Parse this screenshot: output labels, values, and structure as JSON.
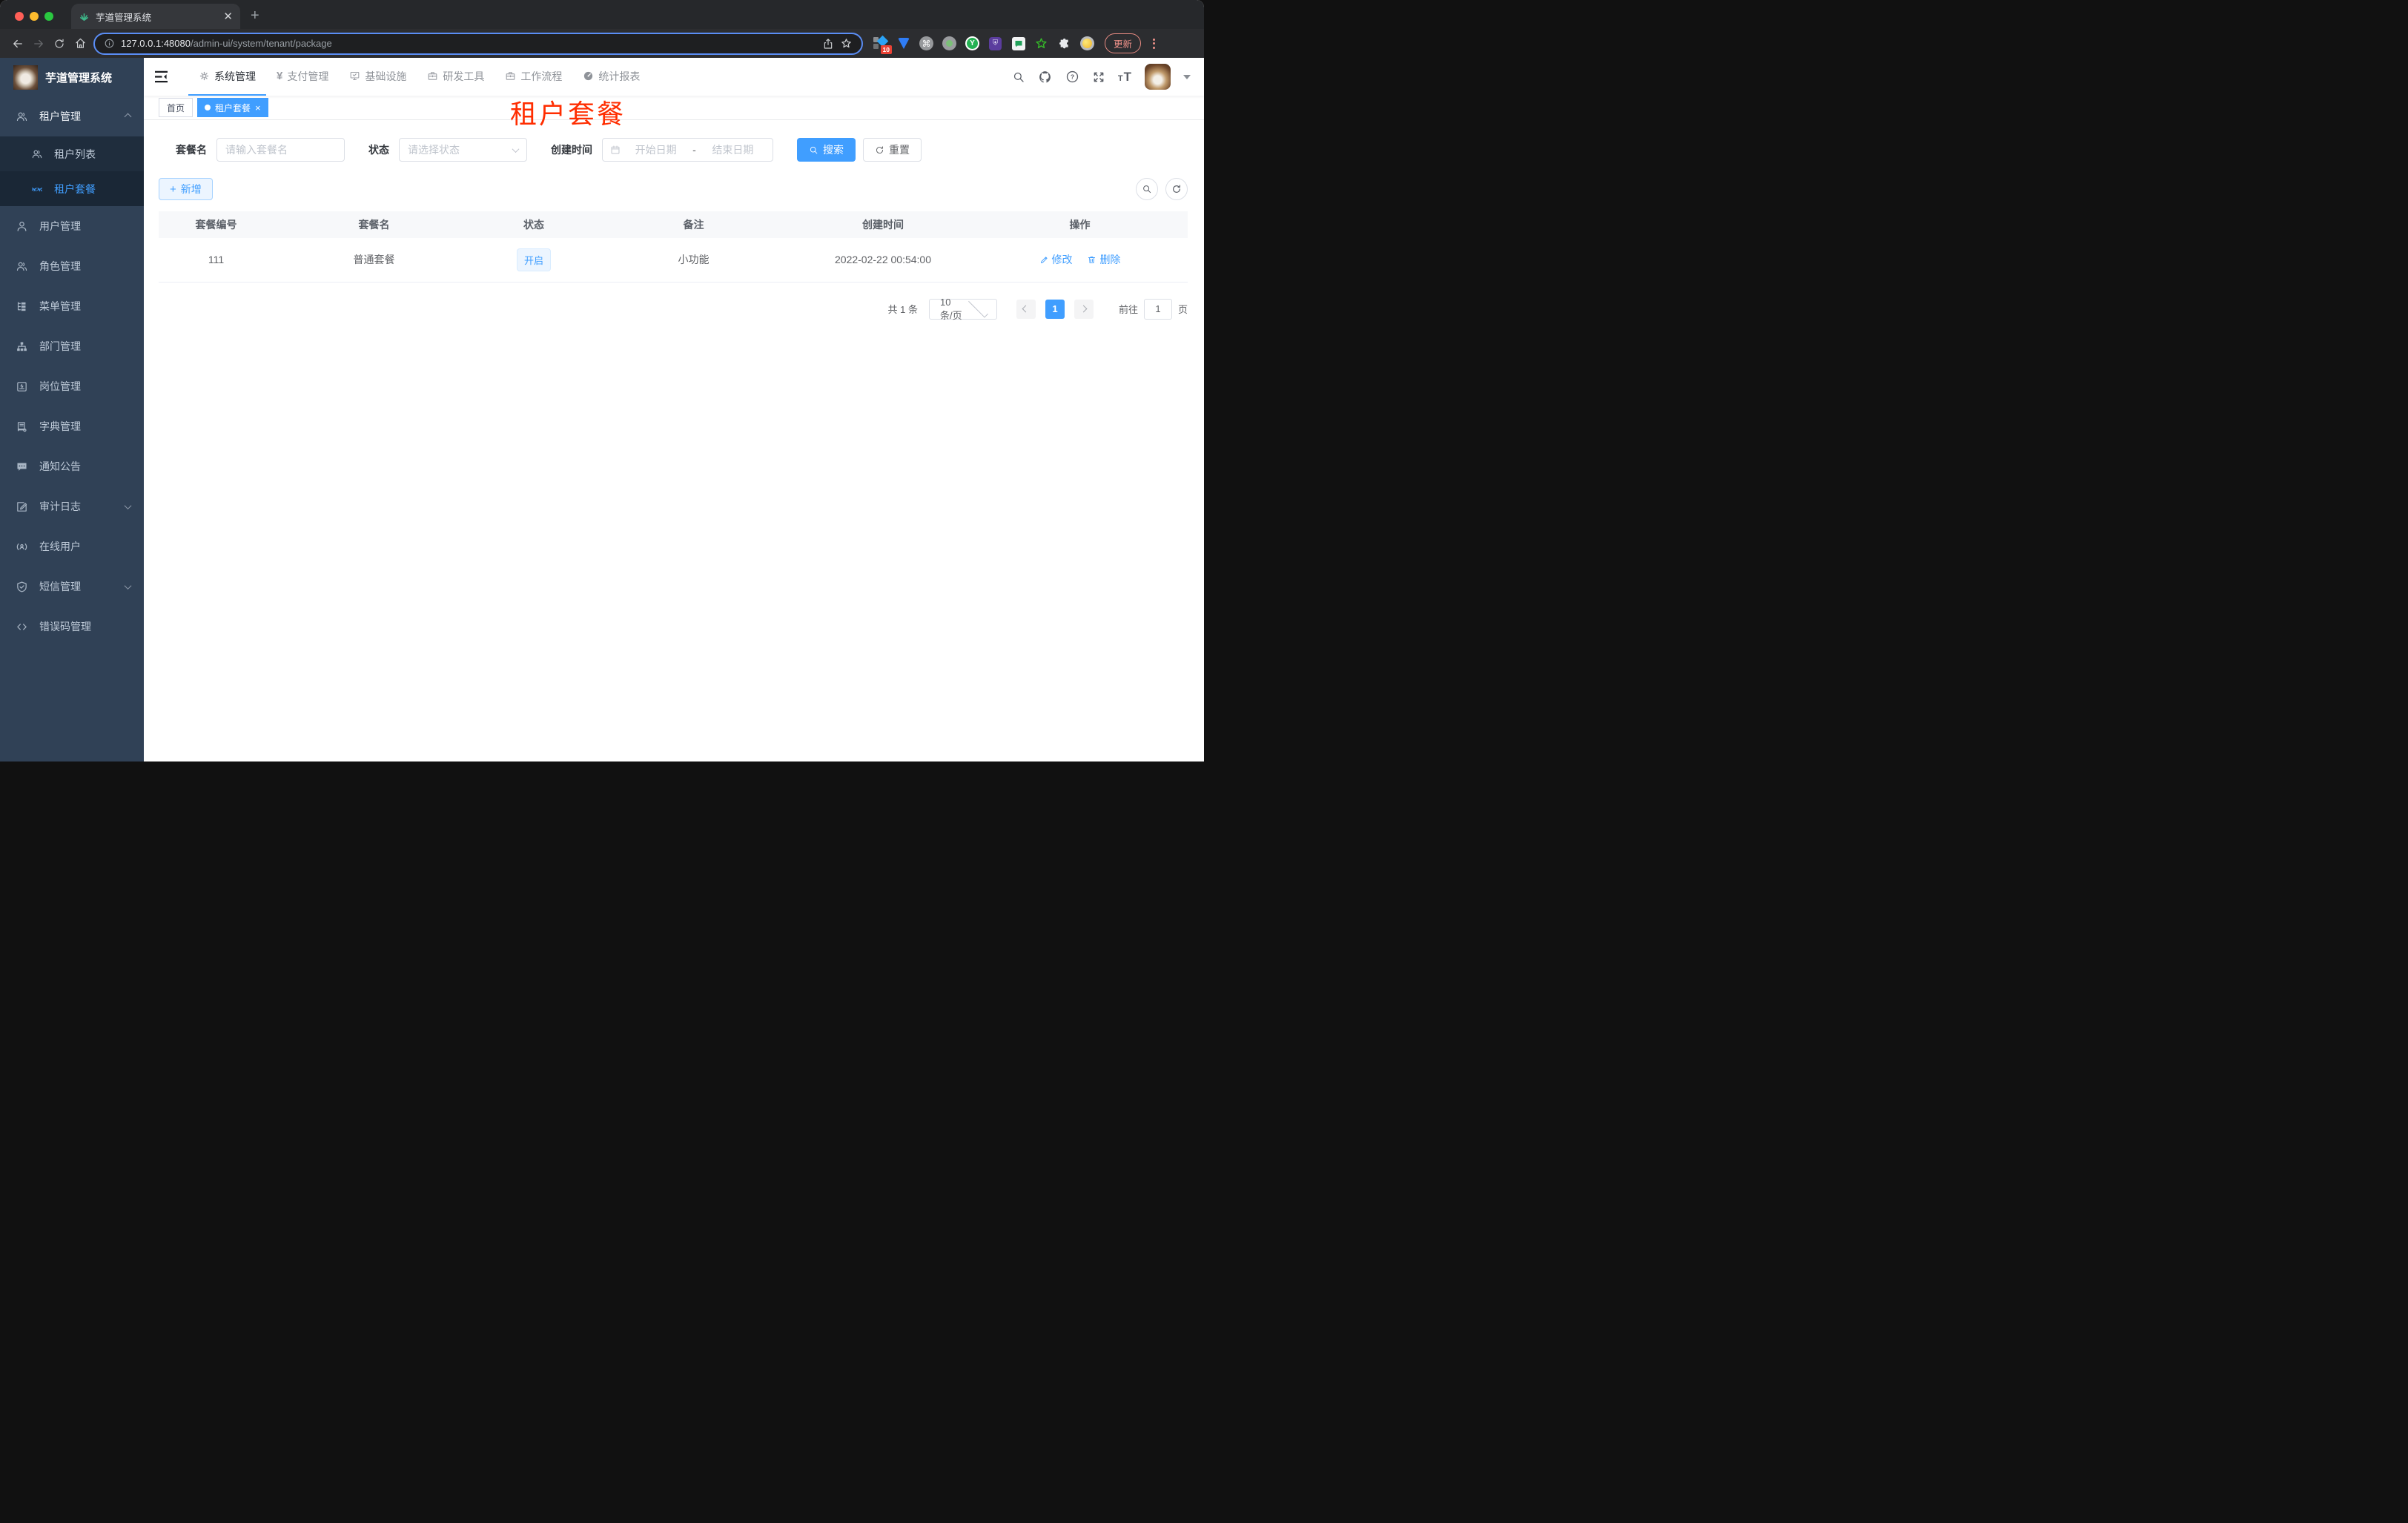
{
  "colors": {
    "accent": "#409EFF",
    "annotation_red": "#FF2D00",
    "sidebar_bg": "#304156",
    "submenu_bg": "#1F2D3D",
    "status_badge_bg": "#ECF5FF"
  },
  "browser": {
    "tab": {
      "title": "芋道管理系统",
      "favicon": "sprout-icon"
    },
    "url_host": "127.0.0.1:48080",
    "url_path": "/admin-ui/system/tenant/package",
    "extensions": [
      "blocker-ext-with-badge",
      "blue-gem-ext",
      "command-ext",
      "gray-green-dot-ext",
      "y-green-ext",
      "purple-shield-ext",
      "green-chat-ext",
      "green-star-ext",
      "puzzle-ext",
      "emoji-ext"
    ],
    "ext_badge": "10",
    "update_label": "更新"
  },
  "sidebar": {
    "logo_title": "芋道管理系统",
    "menu": [
      {
        "label": "租户管理",
        "icon": "tenants-icon"
      },
      {
        "label": "租户列表",
        "icon": "tenant-list-icon"
      },
      {
        "label": "租户套餐",
        "icon": "tenant-package-icon"
      },
      {
        "label": "用户管理",
        "icon": "user-icon"
      },
      {
        "label": "角色管理",
        "icon": "role-icon"
      },
      {
        "label": "菜单管理",
        "icon": "menu-tree-icon"
      },
      {
        "label": "部门管理",
        "icon": "dept-icon"
      },
      {
        "label": "岗位管理",
        "icon": "post-icon"
      },
      {
        "label": "字典管理",
        "icon": "dict-icon"
      },
      {
        "label": "通知公告",
        "icon": "notice-icon"
      },
      {
        "label": "审计日志",
        "icon": "audit-icon"
      },
      {
        "label": "在线用户",
        "icon": "online-icon"
      },
      {
        "label": "短信管理",
        "icon": "sms-icon"
      },
      {
        "label": "错误码管理",
        "icon": "errcode-icon"
      }
    ]
  },
  "topnav": {
    "items": [
      {
        "label": "系统管理",
        "icon": "gear-icon"
      },
      {
        "label": "支付管理",
        "icon": "yen-icon"
      },
      {
        "label": "基础设施",
        "icon": "monitor-icon"
      },
      {
        "label": "研发工具",
        "icon": "briefcase-icon"
      },
      {
        "label": "工作流程",
        "icon": "briefcase-icon"
      },
      {
        "label": "统计报表",
        "icon": "dashboard-icon"
      }
    ]
  },
  "tags": {
    "home": "首页",
    "active": "租户套餐"
  },
  "annotation": {
    "text": "租户套餐",
    "color": "#FF2D00"
  },
  "filters": {
    "name_label": "套餐名",
    "name_placeholder": "请输入套餐名",
    "status_label": "状态",
    "status_placeholder": "请选择状态",
    "date_label": "创建时间",
    "date_start_placeholder": "开始日期",
    "date_separator": "-",
    "date_end_placeholder": "结束日期",
    "search_label": "搜索",
    "reset_label": "重置"
  },
  "toolbar": {
    "add_label": "新增"
  },
  "table": {
    "columns": [
      "套餐编号",
      "套餐名",
      "状态",
      "备注",
      "创建时间",
      "操作"
    ],
    "rows": [
      {
        "id": "111",
        "name": "普通套餐",
        "status": "开启",
        "remark": "小功能",
        "created": "2022-02-22 00:54:00",
        "actions": [
          "修改",
          "删除"
        ]
      }
    ]
  },
  "pagination": {
    "total": "共 1 条",
    "page_size": "10条/页",
    "current": "1",
    "goto_label": "前往",
    "goto_value": "1",
    "page_unit": "页"
  }
}
